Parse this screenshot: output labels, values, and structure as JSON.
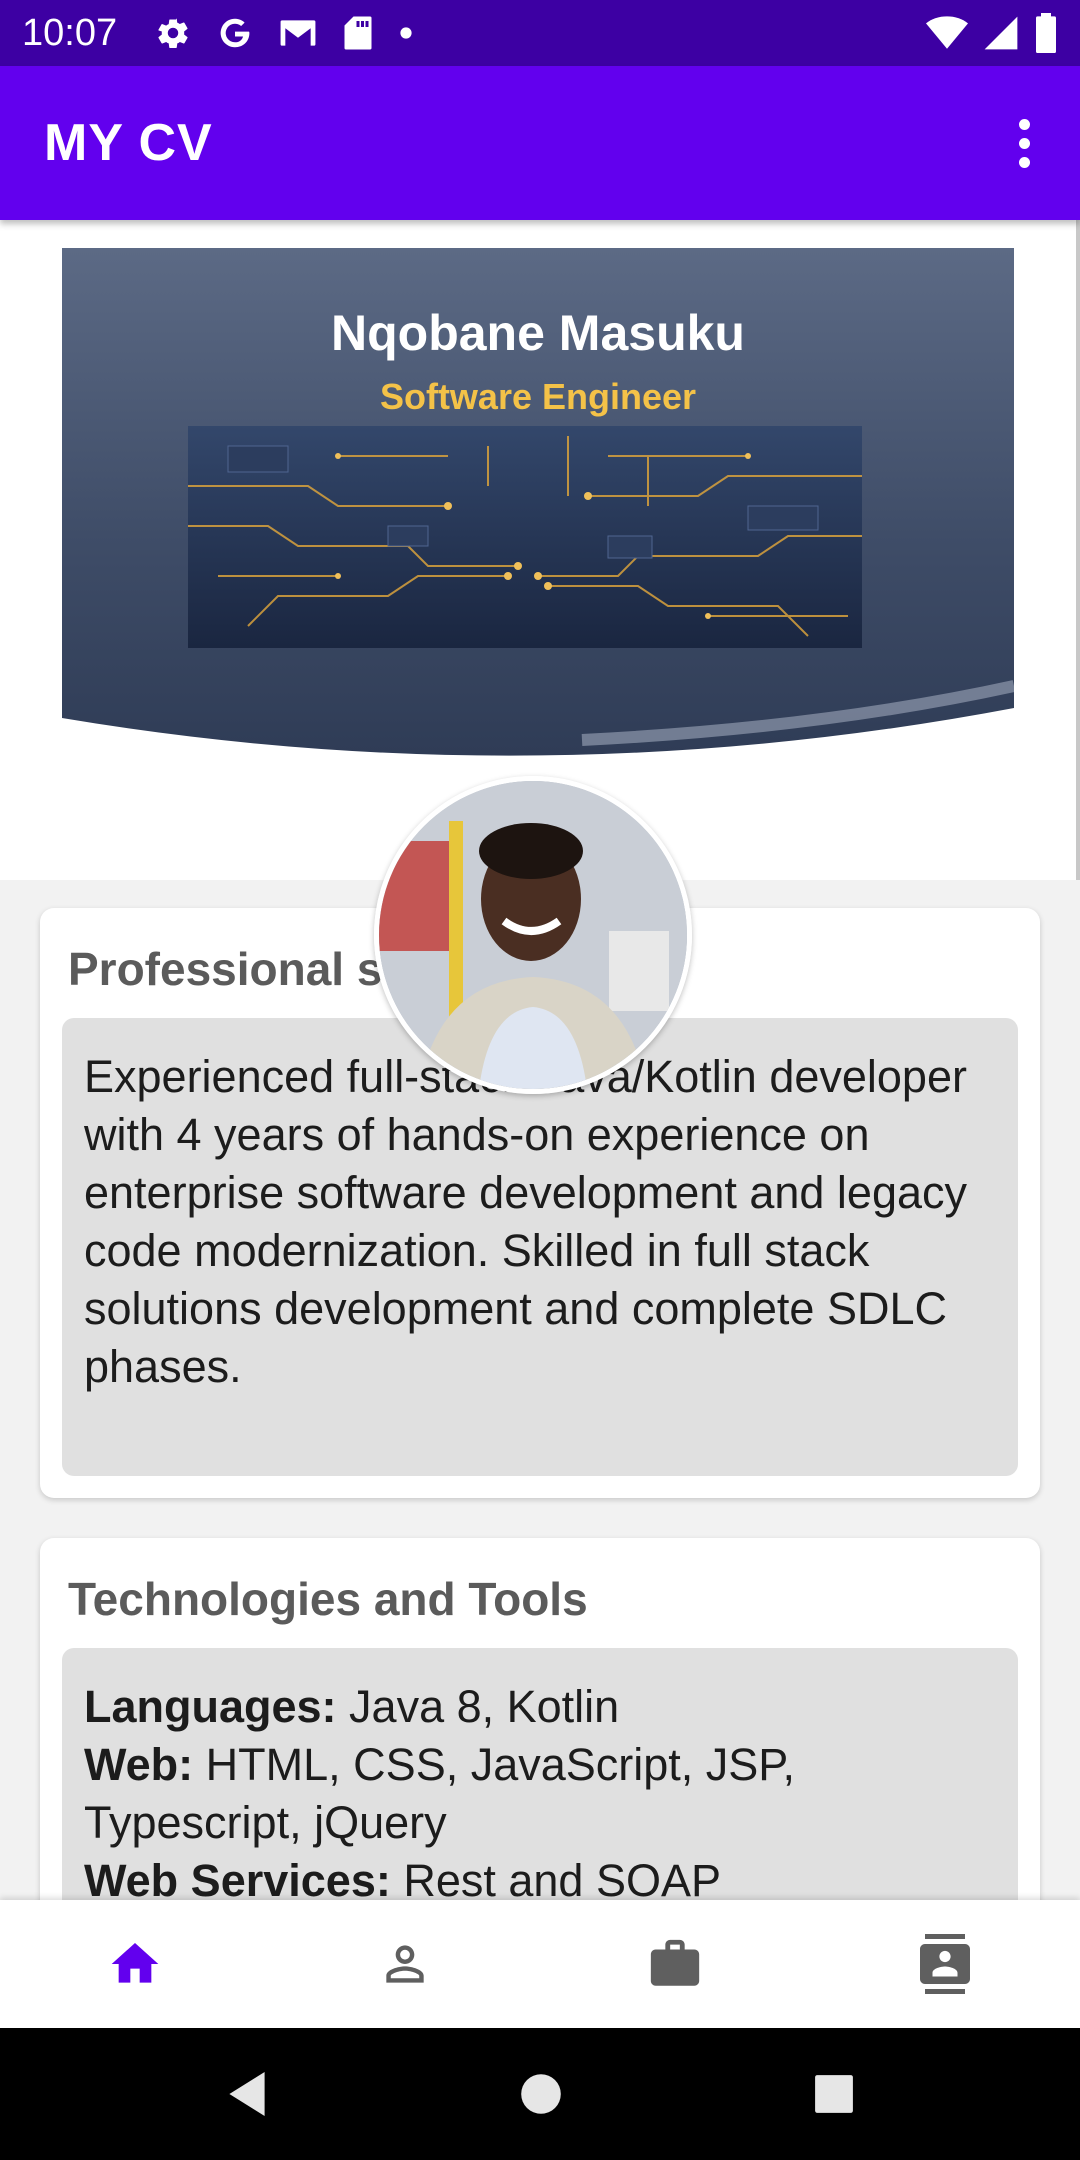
{
  "status_bar": {
    "time": "10:07",
    "left_icons": [
      "gear-icon",
      "google-icon",
      "gmail-icon",
      "sd-card-icon",
      "dot-icon"
    ],
    "right_icons": [
      "wifi-icon",
      "signal-icon",
      "battery-icon"
    ]
  },
  "app_bar": {
    "title": "MY CV",
    "overflow_icon": "more-vert-icon"
  },
  "header": {
    "name": "Nqobane Masuku",
    "role": "Software Engineer"
  },
  "summary": {
    "title": "Professional summary",
    "text": "Experienced full-stack Java/Kotlin developer with 4 years of hands-on experience on enterprise software development and legacy code modernization. Skilled in full stack solutions development and complete SDLC phases."
  },
  "technologies": {
    "title": "Technologies and Tools",
    "rows": [
      {
        "label": "Languages:",
        "value": " Java 8, Kotlin"
      },
      {
        "label": "Web:",
        "value": " HTML, CSS, JavaScript, JSP, Typescript, jQuery"
      },
      {
        "label": "Web Services:",
        "value": " Rest and SOAP"
      }
    ]
  },
  "bottom_nav": {
    "items": [
      {
        "icon": "home-icon",
        "active": true
      },
      {
        "icon": "person-icon",
        "active": false
      },
      {
        "icon": "briefcase-icon",
        "active": false
      },
      {
        "icon": "contact-icon",
        "active": false
      }
    ],
    "active_color": "#6200ee",
    "inactive_color": "#5f5f5f"
  },
  "colors": {
    "status_bar": "#3d00a3",
    "app_bar": "#6200ee",
    "role_text": "#f4c248"
  }
}
